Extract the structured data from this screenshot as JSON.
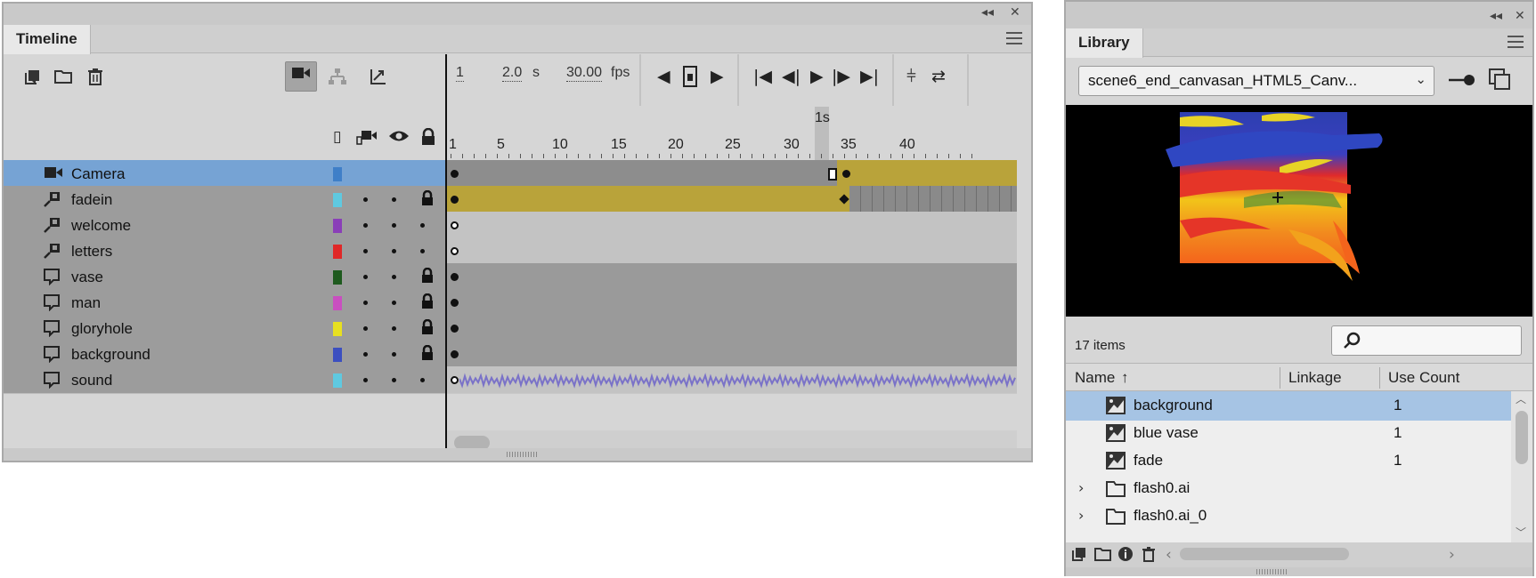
{
  "timeline": {
    "tab_label": "Timeline",
    "collapse_glyph": "◂◂",
    "close_glyph": "✕",
    "toolbar": {
      "current_frame": "1",
      "time": "2.0",
      "time_unit": "s",
      "fps_value": "30.00",
      "fps_unit": "fps"
    },
    "ruler": {
      "labels": [
        "1",
        "5",
        "10",
        "15",
        "20",
        "25",
        "30",
        "35",
        "40"
      ],
      "playhead_label": "1s"
    },
    "layers": [
      {
        "name": "Camera",
        "type": "camera",
        "color": "#3f7fc8",
        "selected": true,
        "show": false,
        "lock": false,
        "frames": "camera"
      },
      {
        "name": "fadein",
        "type": "guide",
        "color": "#5fc9e0",
        "show": true,
        "lock": true,
        "frames": "tween"
      },
      {
        "name": "welcome",
        "type": "guide",
        "color": "#8a3fb8",
        "show": true,
        "lock": false,
        "frames": "empty"
      },
      {
        "name": "letters",
        "type": "guide",
        "color": "#e02828",
        "show": true,
        "lock": false,
        "frames": "empty"
      },
      {
        "name": "vase",
        "type": "layer",
        "color": "#1e5a1e",
        "show": true,
        "lock": true,
        "frames": "filled"
      },
      {
        "name": "man",
        "type": "layer",
        "color": "#c94fc0",
        "show": true,
        "lock": true,
        "frames": "filled"
      },
      {
        "name": "gloryhole",
        "type": "layer",
        "color": "#e8e020",
        "show": true,
        "lock": true,
        "frames": "filled"
      },
      {
        "name": "background",
        "type": "layer",
        "color": "#3c4fc0",
        "show": true,
        "lock": true,
        "frames": "filled"
      },
      {
        "name": "sound",
        "type": "layer",
        "color": "#5fc9e0",
        "show": true,
        "lock": false,
        "frames": "sound"
      }
    ]
  },
  "library": {
    "tab_label": "Library",
    "collapse_glyph": "◂◂",
    "close_glyph": "✕",
    "document_select": "scene6_end_canvasan_HTML5_Canv...",
    "item_count": "17 items",
    "columns": {
      "name": "Name",
      "sort_arrow": "↑",
      "linkage": "Linkage",
      "use_count": "Use Count"
    },
    "items": [
      {
        "name": "background",
        "type": "movieclip",
        "use_count": "1",
        "selected": true
      },
      {
        "name": "blue vase",
        "type": "movieclip",
        "use_count": "1"
      },
      {
        "name": "fade",
        "type": "movieclip",
        "use_count": "1"
      },
      {
        "name": "flash0.ai",
        "type": "folder",
        "use_count": ""
      },
      {
        "name": "flash0.ai_0",
        "type": "folder",
        "use_count": ""
      }
    ],
    "colors": {
      "preview_bg": "#000000",
      "selection": "#a6c4e4"
    }
  }
}
